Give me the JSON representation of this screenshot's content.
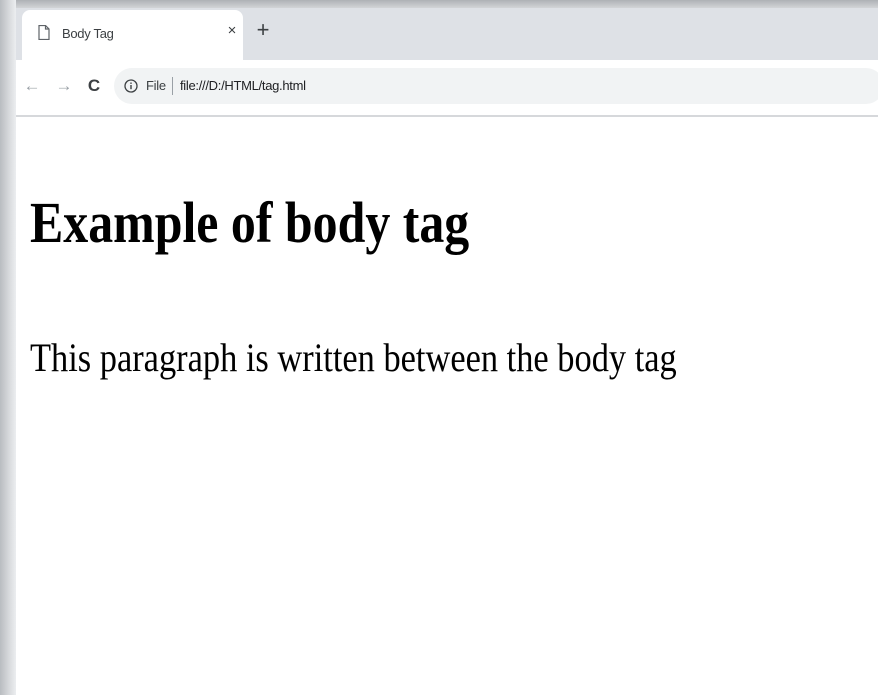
{
  "browser": {
    "tab": {
      "title": "Body Tag",
      "close_glyph": "×",
      "icon": "page-icon"
    },
    "new_tab_glyph": "+",
    "nav": {
      "back_glyph": "←",
      "forward_glyph": "→",
      "reload_glyph": "C"
    },
    "omnibox": {
      "security_icon": "info-icon",
      "scheme_label": "File",
      "url": "file:///D:/HTML/tag.html"
    },
    "colors": {
      "tabstrip": "#dee1e6",
      "omnibox": "#f1f3f4",
      "text": "#3c4043"
    }
  },
  "page": {
    "heading": "Example of body tag",
    "paragraph": "This paragraph is written between the body tag"
  }
}
